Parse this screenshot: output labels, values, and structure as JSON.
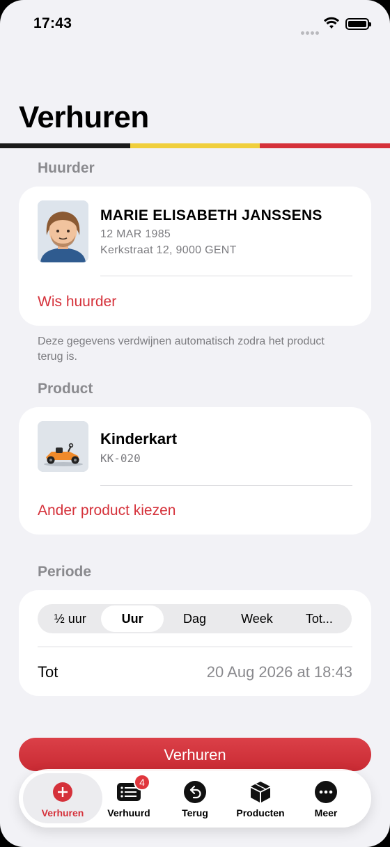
{
  "status_bar": {
    "time": "17:43"
  },
  "page": {
    "title": "Verhuren"
  },
  "flag_colors": [
    "#1a1a1a",
    "#f0cf3c",
    "#d5313a"
  ],
  "renter": {
    "section_label": "Huurder",
    "name": "MARIE ELISABETH JANSSENS",
    "birthdate": "12 MAR 1985",
    "address": "Kerkstraat 12, 9000 GENT",
    "clear_label": "Wis huurder",
    "note": "Deze gegevens verdwijnen automatisch zodra het product terug is."
  },
  "product": {
    "section_label": "Product",
    "name": "Kinderkart",
    "code": "KK-020",
    "change_label": "Ander product kiezen"
  },
  "period": {
    "section_label": "Periode",
    "options": [
      "½ uur",
      "Uur",
      "Dag",
      "Week",
      "Tot..."
    ],
    "selected": "Uur",
    "until_label": "Tot",
    "until_value": "20 Aug 2026 at 18:43"
  },
  "primary_action": {
    "label": "Verhuren"
  },
  "tab_bar": {
    "items": [
      {
        "label": "Verhuren",
        "icon": "plus-circle-icon",
        "active": true
      },
      {
        "label": "Verhuurd",
        "icon": "list-icon",
        "badge": "4"
      },
      {
        "label": "Terug",
        "icon": "return-icon"
      },
      {
        "label": "Producten",
        "icon": "box-icon"
      },
      {
        "label": "Meer",
        "icon": "more-icon"
      }
    ]
  },
  "colors": {
    "accent": "#d5313a",
    "background": "#f2f2f6"
  }
}
